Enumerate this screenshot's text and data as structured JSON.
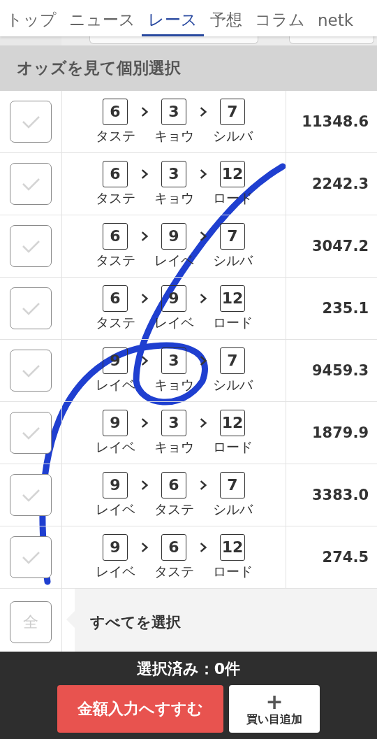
{
  "tabs": [
    {
      "label": "トップ",
      "selected": false
    },
    {
      "label": "ニュース",
      "selected": false
    },
    {
      "label": "レース",
      "selected": true
    },
    {
      "label": "予想",
      "selected": false
    },
    {
      "label": "コラム",
      "selected": false
    },
    {
      "label": "netk",
      "selected": false
    }
  ],
  "section_title": "オッズを見て個別選択",
  "rows": [
    {
      "checked": false,
      "horses": [
        {
          "number": "6",
          "name": "タステ"
        },
        {
          "number": "3",
          "name": "キョウ"
        },
        {
          "number": "7",
          "name": "シルバ"
        }
      ],
      "odds": "11348.6"
    },
    {
      "checked": false,
      "horses": [
        {
          "number": "6",
          "name": "タステ"
        },
        {
          "number": "3",
          "name": "キョウ"
        },
        {
          "number": "12",
          "name": "ロード"
        }
      ],
      "odds": "2242.3"
    },
    {
      "checked": false,
      "horses": [
        {
          "number": "6",
          "name": "タステ"
        },
        {
          "number": "9",
          "name": "レイベ"
        },
        {
          "number": "7",
          "name": "シルバ"
        }
      ],
      "odds": "3047.2"
    },
    {
      "checked": false,
      "horses": [
        {
          "number": "6",
          "name": "タステ"
        },
        {
          "number": "9",
          "name": "レイベ"
        },
        {
          "number": "12",
          "name": "ロード"
        }
      ],
      "odds": "235.1"
    },
    {
      "checked": false,
      "horses": [
        {
          "number": "9",
          "name": "レイベ"
        },
        {
          "number": "3",
          "name": "キョウ"
        },
        {
          "number": "7",
          "name": "シルバ"
        }
      ],
      "odds": "9459.3"
    },
    {
      "checked": false,
      "horses": [
        {
          "number": "9",
          "name": "レイベ"
        },
        {
          "number": "3",
          "name": "キョウ"
        },
        {
          "number": "12",
          "name": "ロード"
        }
      ],
      "odds": "1879.9"
    },
    {
      "checked": false,
      "horses": [
        {
          "number": "9",
          "name": "レイベ"
        },
        {
          "number": "6",
          "name": "タステ"
        },
        {
          "number": "7",
          "name": "シルバ"
        }
      ],
      "odds": "3383.0"
    },
    {
      "checked": false,
      "horses": [
        {
          "number": "9",
          "name": "レイベ"
        },
        {
          "number": "6",
          "name": "タステ"
        },
        {
          "number": "12",
          "name": "ロード"
        }
      ],
      "odds": "274.5"
    }
  ],
  "select_all": {
    "box_label": "全",
    "label": "すべてを選択",
    "checked": false
  },
  "bottom_bar": {
    "selected_count": "選択済み：0件",
    "primary_button": "金額入力へすすむ",
    "add_button_icon": "+",
    "add_button": "買い目追加"
  }
}
